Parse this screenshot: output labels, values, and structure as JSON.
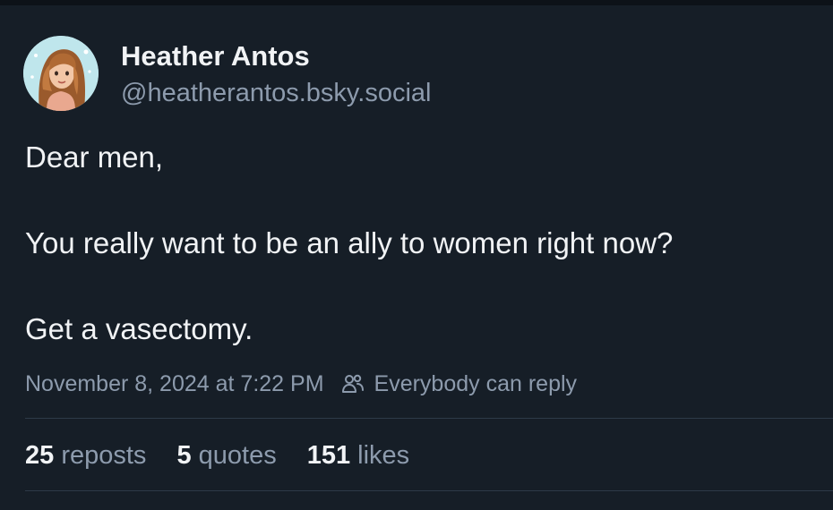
{
  "author": {
    "name": "Heather Antos",
    "handle": "@heatherantos.bsky.social",
    "avatar_icon": "user-avatar-illustration"
  },
  "post": {
    "lines": [
      "Dear men,",
      "You really want to be an ally to women right now?",
      "Get a vasectomy."
    ],
    "timestamp": "November 8, 2024 at 7:22 PM",
    "reply_setting_icon": "people-icon",
    "reply_setting": "Everybody can reply"
  },
  "stats": {
    "reposts_count": "25",
    "reposts_label": "reposts",
    "quotes_count": "5",
    "quotes_label": "quotes",
    "likes_count": "151",
    "likes_label": "likes"
  },
  "colors": {
    "background": "#161e27",
    "text": "#f1f3f5",
    "muted": "#8d9bad",
    "divider": "#2e3a48"
  }
}
